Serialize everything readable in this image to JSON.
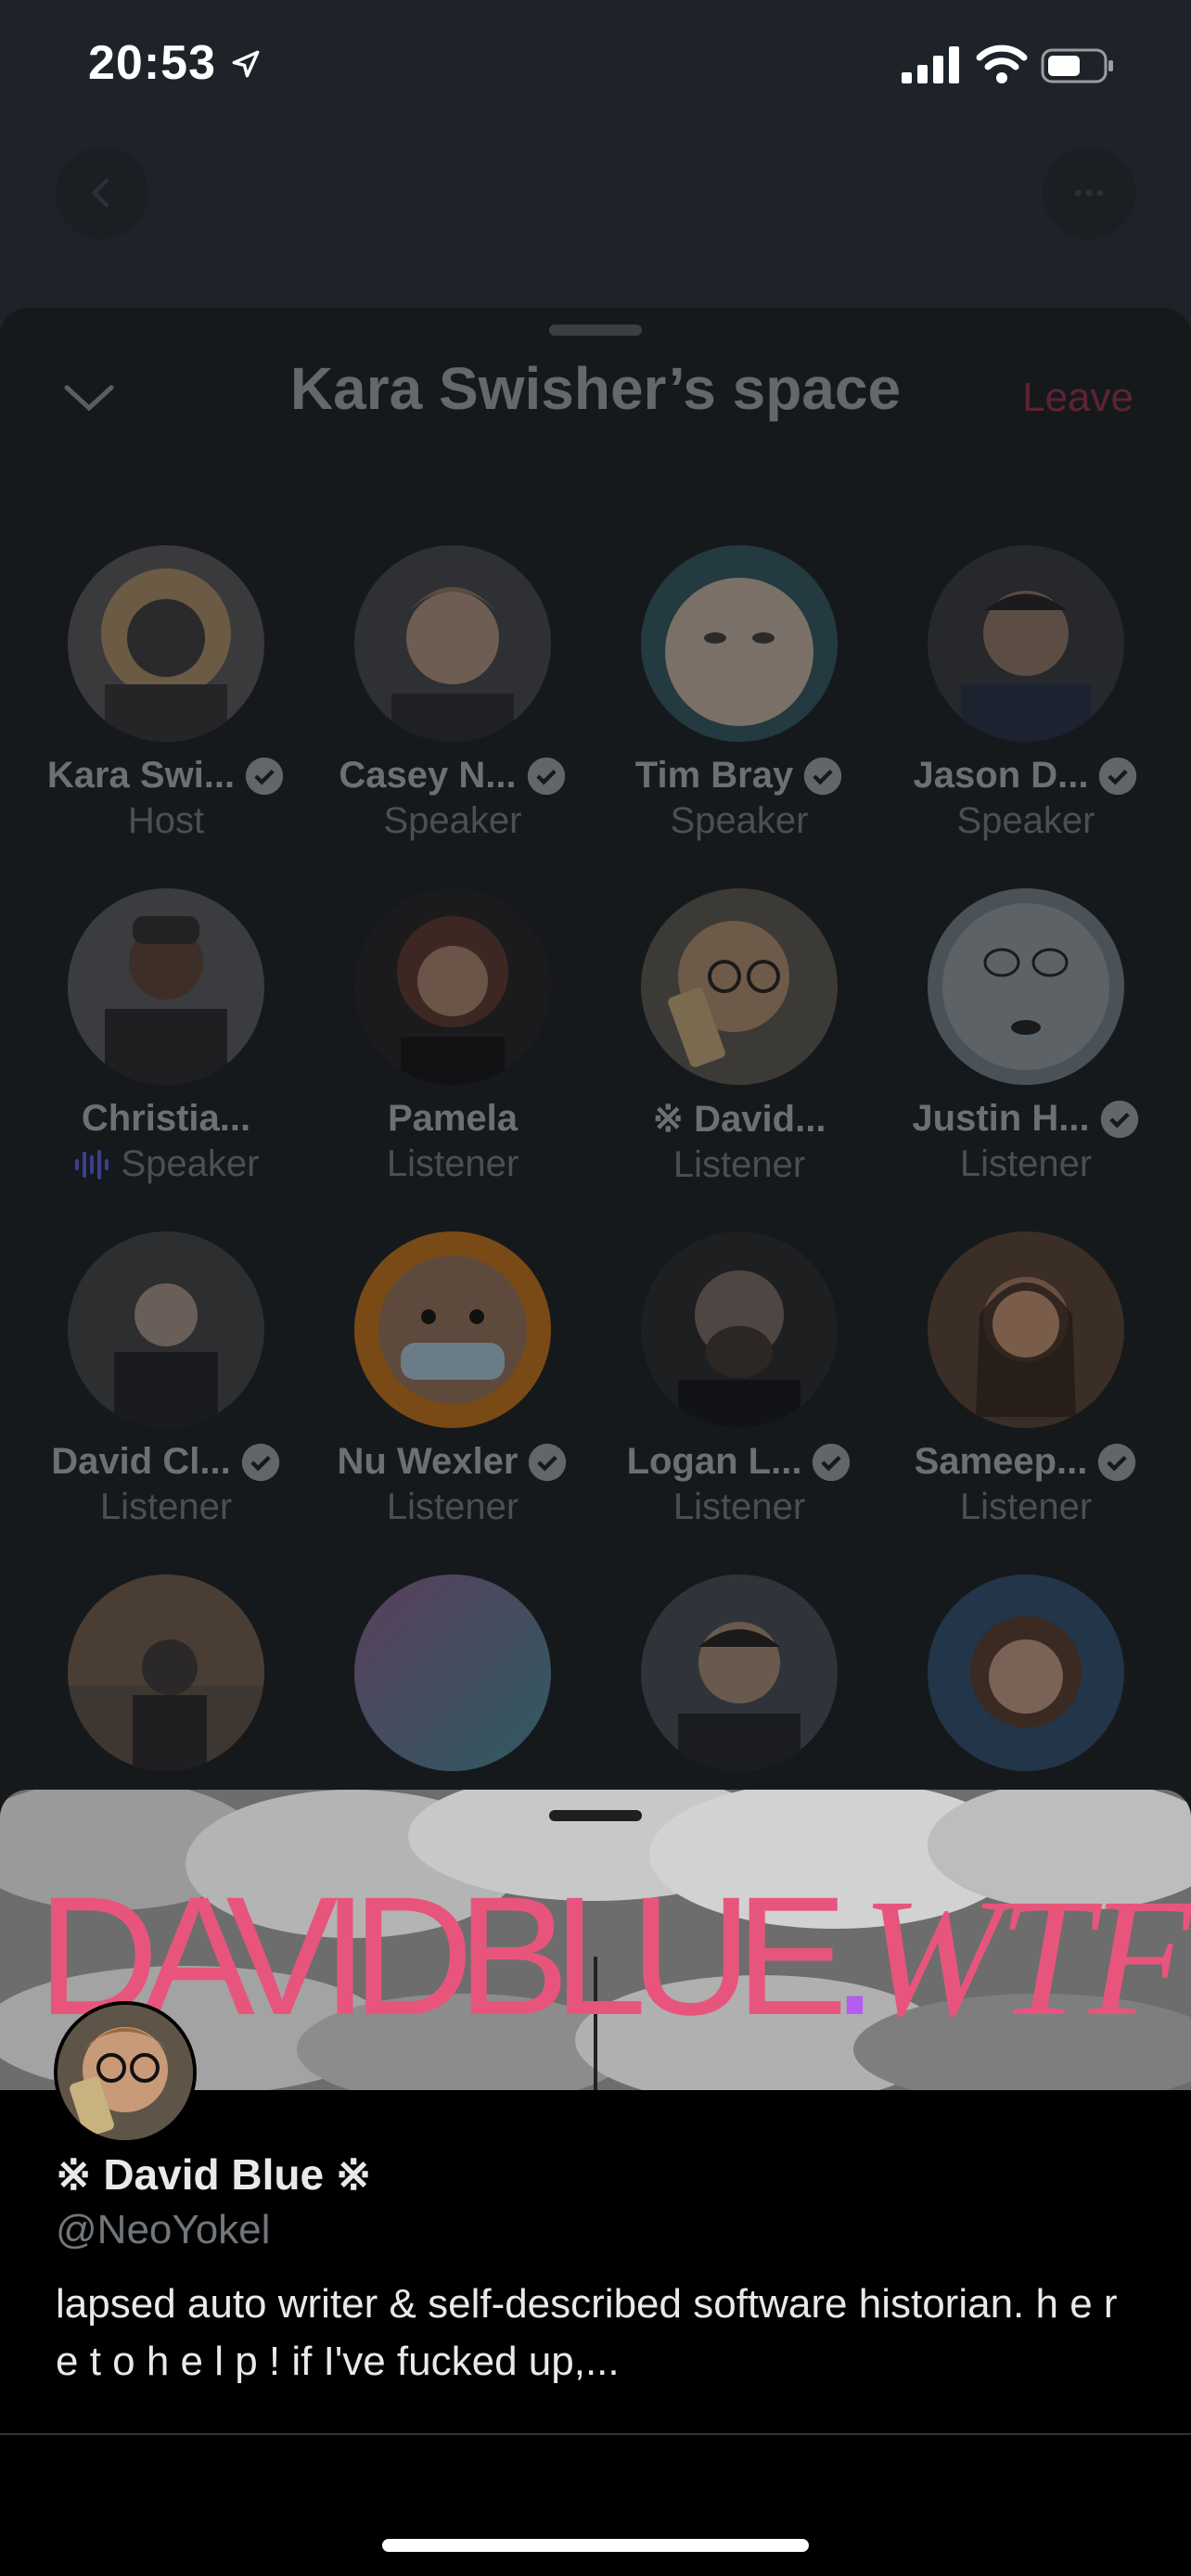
{
  "status_bar": {
    "time": "20:53",
    "icons": [
      "location-arrow-icon",
      "signal-icon",
      "wifi-icon",
      "battery-icon"
    ]
  },
  "top_nav": {
    "back_icon": "chevron-left-icon",
    "more_icon": "more-horizontal-icon"
  },
  "space": {
    "title": "Kara Swisher’s space",
    "leave_label": "Leave",
    "collapse_icon": "chevron-down-icon",
    "participants": [
      {
        "name": "Kara Swi...",
        "role": "Host",
        "verified": true
      },
      {
        "name": "Casey N...",
        "role": "Speaker",
        "verified": true
      },
      {
        "name": "Tim Bray",
        "role": "Speaker",
        "verified": true
      },
      {
        "name": "Jason D...",
        "role": "Speaker",
        "verified": true
      },
      {
        "name": "Christia...",
        "role": "Speaker",
        "verified": false,
        "speaking": true
      },
      {
        "name": "Pamela",
        "role": "Listener",
        "verified": false
      },
      {
        "name": "※ David...",
        "role": "Listener",
        "verified": false
      },
      {
        "name": "Justin H...",
        "role": "Listener",
        "verified": true
      },
      {
        "name": "David Cl...",
        "role": "Listener",
        "verified": true
      },
      {
        "name": "Nu Wexler",
        "role": "Listener",
        "verified": true
      },
      {
        "name": "Logan L...",
        "role": "Listener",
        "verified": true
      },
      {
        "name": "Sameep...",
        "role": "Listener",
        "verified": true
      },
      {
        "name": "",
        "role": ""
      },
      {
        "name": "",
        "role": ""
      },
      {
        "name": "",
        "role": ""
      },
      {
        "name": "",
        "role": ""
      }
    ]
  },
  "profile": {
    "banner_text_main": "DAVIDBLUE",
    "banner_text_dot": ".",
    "banner_text_tld": "WTF",
    "display_name": "※ David Blue ※",
    "handle": "@NeoYokel",
    "bio": "lapsed auto writer & self-described software historian. h e r e  t o  h e l p ! if I've fucked up,...",
    "colors": {
      "banner_text": "#e8557c",
      "banner_dot": "#b45cf2"
    }
  }
}
